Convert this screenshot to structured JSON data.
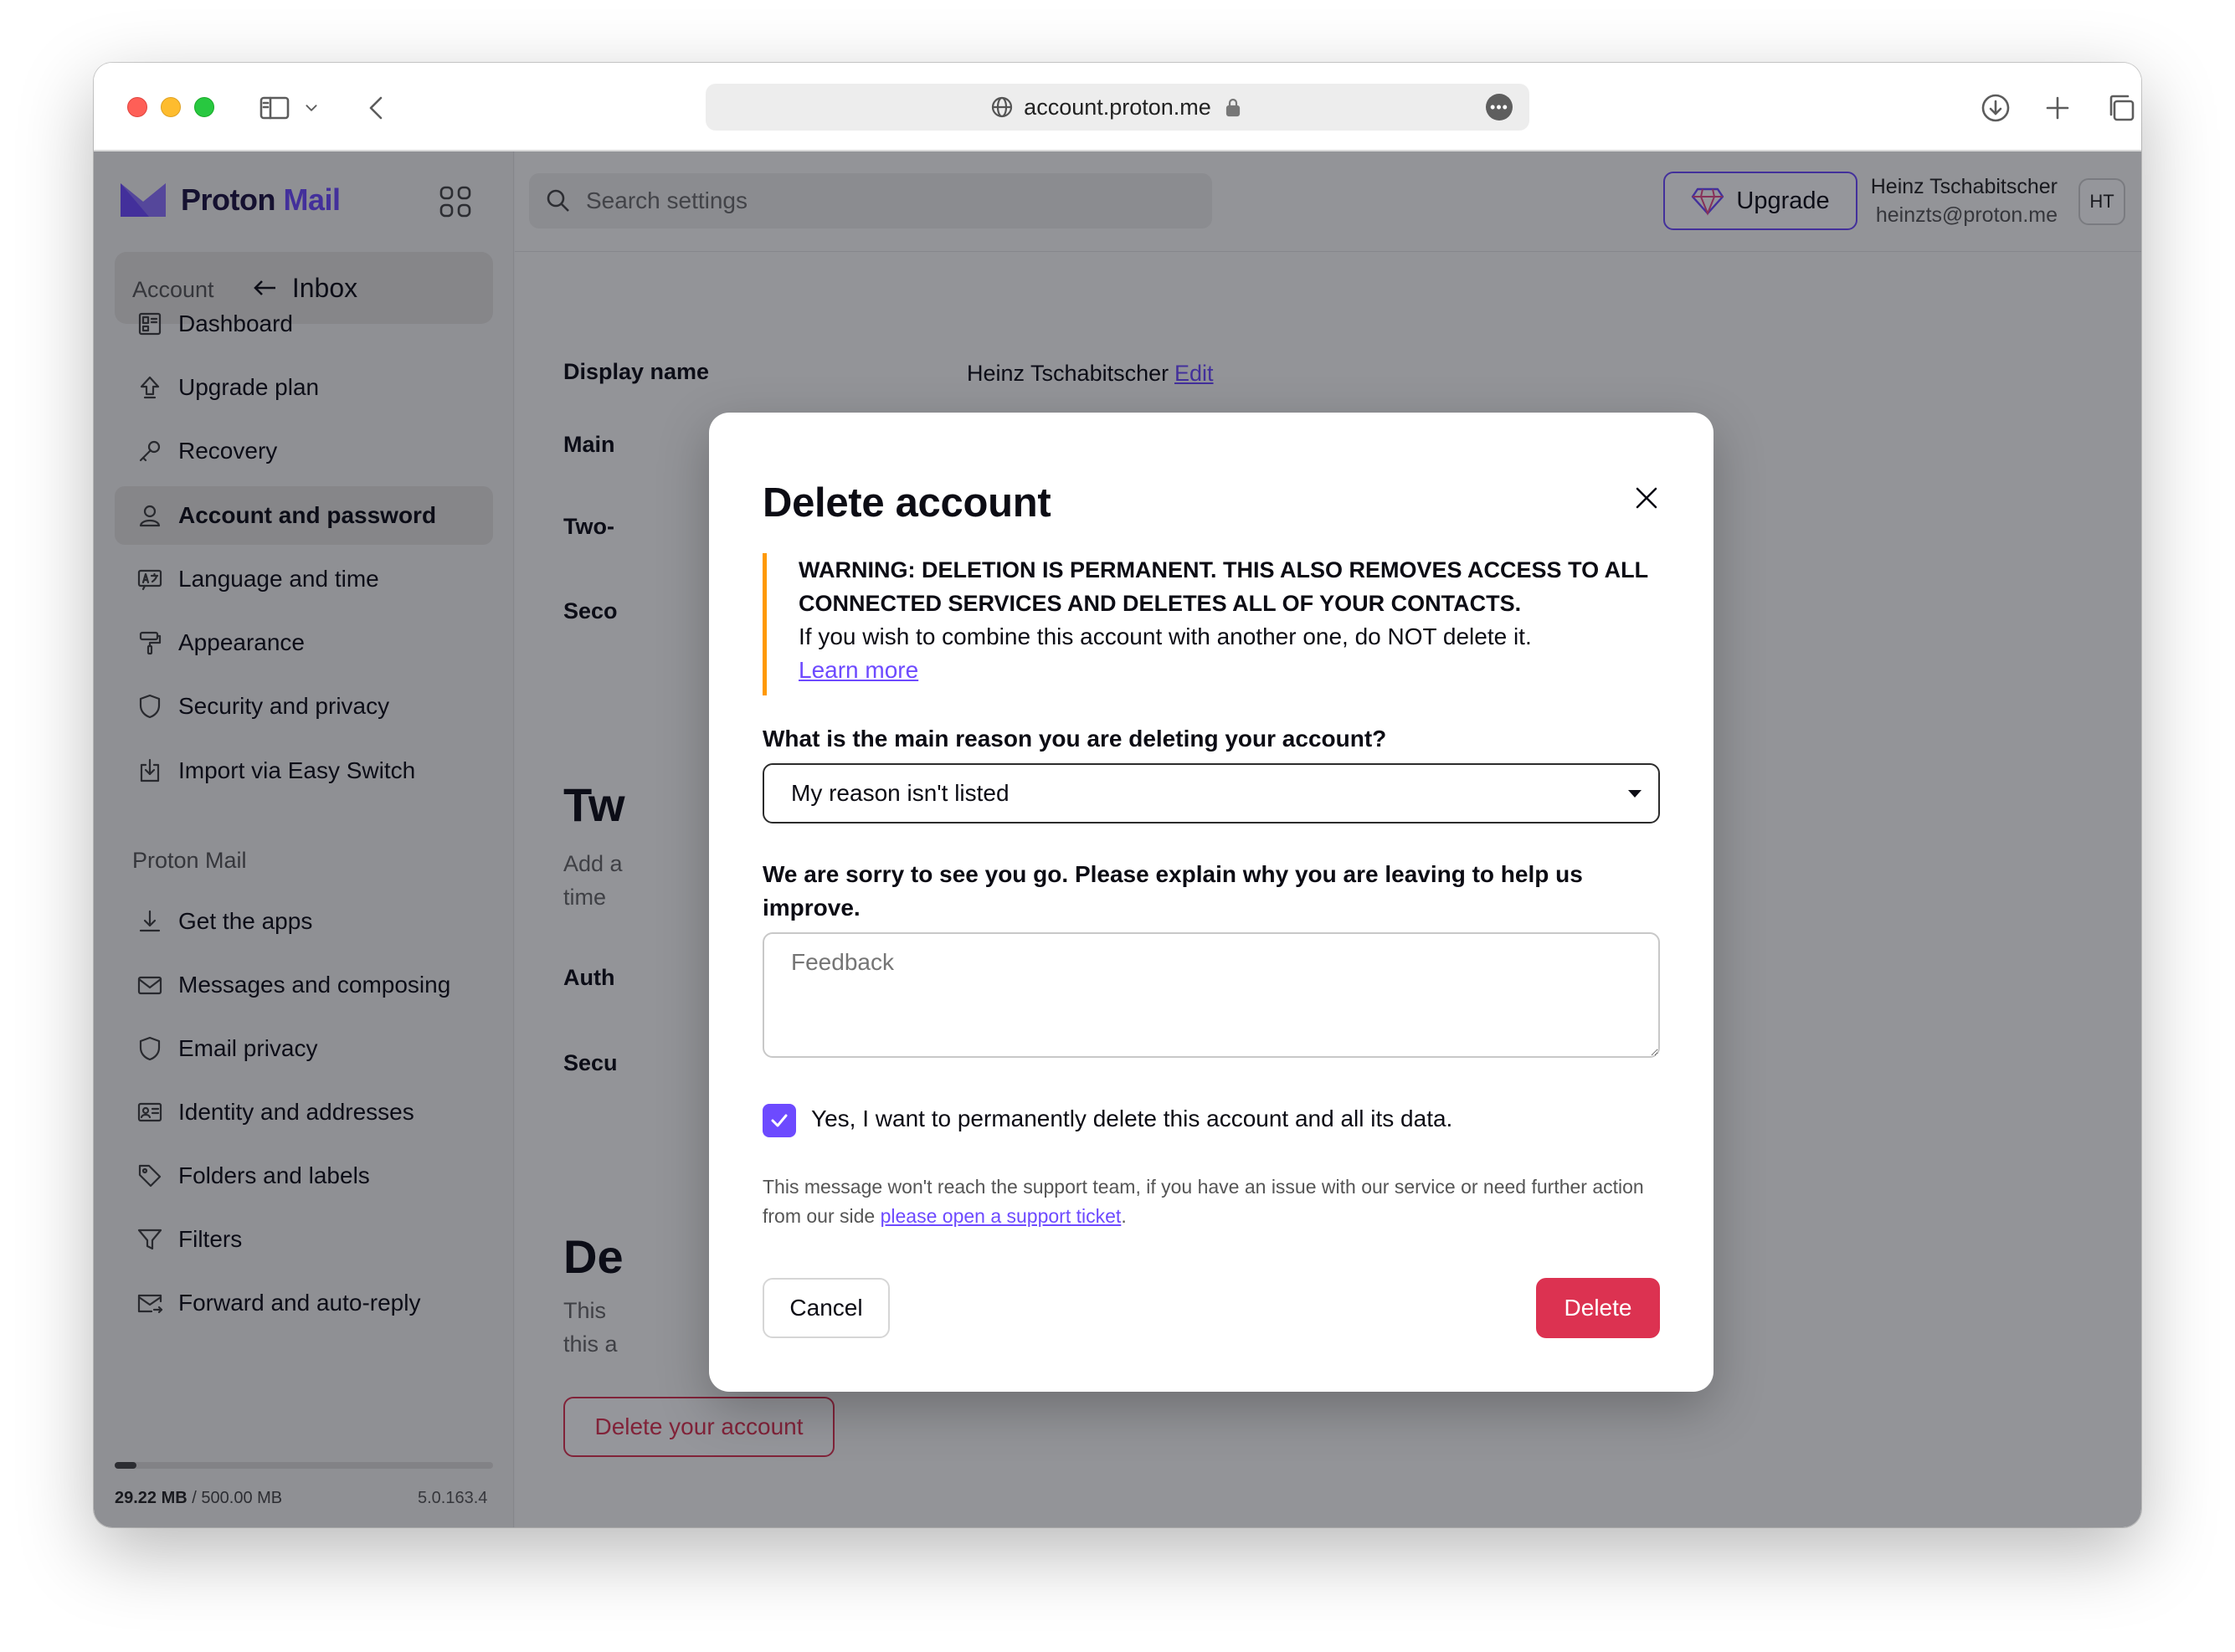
{
  "browser": {
    "url": "account.proton.me"
  },
  "brand": {
    "name_primary": "Proton",
    "name_secondary": "Mail",
    "accent": "#6d4aff",
    "danger": "#dc3251",
    "warning": "#ff9900"
  },
  "sidebar": {
    "inbox_label": "Inbox",
    "account_section": "Account",
    "account_items": [
      {
        "label": "Dashboard",
        "icon": "dashboard-icon"
      },
      {
        "label": "Upgrade plan",
        "icon": "upgrade-arrow-icon"
      },
      {
        "label": "Recovery",
        "icon": "key-icon"
      },
      {
        "label": "Account and password",
        "icon": "user-icon",
        "active": true
      },
      {
        "label": "Language and time",
        "icon": "language-icon"
      },
      {
        "label": "Appearance",
        "icon": "paint-roller-icon"
      },
      {
        "label": "Security and privacy",
        "icon": "shield-icon"
      },
      {
        "label": "Import via Easy Switch",
        "icon": "import-icon"
      }
    ],
    "mail_section": "Proton Mail",
    "mail_items": [
      {
        "label": "Get the apps",
        "icon": "download-icon"
      },
      {
        "label": "Messages and composing",
        "icon": "envelope-icon"
      },
      {
        "label": "Email privacy",
        "icon": "shield-icon"
      },
      {
        "label": "Identity and addresses",
        "icon": "id-card-icon"
      },
      {
        "label": "Folders and labels",
        "icon": "tag-icon"
      },
      {
        "label": "Filters",
        "icon": "filter-icon"
      },
      {
        "label": "Forward and auto-reply",
        "icon": "forward-envelope-icon"
      }
    ],
    "storage_used": "29.22 MB",
    "storage_sep": " / ",
    "storage_total": "500.00 MB",
    "storage_fraction": 0.058,
    "version": "5.0.163.4"
  },
  "topbar": {
    "search_placeholder": "Search settings",
    "upgrade_label": "Upgrade",
    "user_name": "Heinz Tschabitscher",
    "user_email": "heinzts@proton.me",
    "avatar_initials": "HT"
  },
  "background": {
    "display_name_label": "Display name",
    "display_name_value": "Heinz Tschabitscher",
    "edit_link": "Edit",
    "row_main": "Main",
    "row_two": "Two-",
    "row_seco": "Seco",
    "heading_tw": "Tw",
    "text_add": "Add a",
    "text_time": "time",
    "row_auth": "Auth",
    "row_secu": "Secu",
    "heading_de": "De",
    "text_this1": "This",
    "text_this2": "this a",
    "delete_account_button": "Delete your account"
  },
  "modal": {
    "title": "Delete account",
    "warning_strong": "WARNING: DELETION IS PERMANENT. THIS ALSO REMOVES ACCESS TO ALL CONNECTED SERVICES AND DELETES ALL OF YOUR CONTACTS.",
    "warning_text": "If you wish to combine this account with another one, do NOT delete it.",
    "learn_more": "Learn more",
    "reason_label": "What is the main reason you are deleting your account?",
    "reason_selected": "My reason isn't listed",
    "feedback_label": "We are sorry to see you go. Please explain why you are leaving to help us improve.",
    "feedback_placeholder": "Feedback",
    "confirm_label": "Yes, I want to permanently delete this account and all its data.",
    "confirm_checked": true,
    "note_text": "This message won't reach the support team, if you have an issue with our service or need further action from our side ",
    "note_link": "please open a support ticket",
    "note_end": ".",
    "cancel_label": "Cancel",
    "delete_label": "Delete"
  }
}
